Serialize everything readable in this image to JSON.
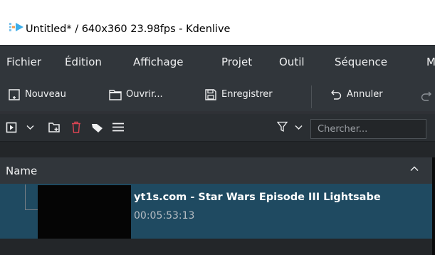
{
  "window": {
    "title": "Untitled* / 640x360 23.98fps - Kdenlive",
    "icon": "kdenlive-icon"
  },
  "menu": {
    "items": [
      "Fichier",
      "Édition",
      "Affichage",
      "Projet",
      "Outil",
      "Séquence",
      "M"
    ]
  },
  "toolbar": {
    "new_label": "Nouveau",
    "open_label": "Ouvrir...",
    "save_label": "Enregistrer",
    "undo_label": "Annuler"
  },
  "bin_toolbar": {
    "search_placeholder": "Chercher..."
  },
  "clip_list": {
    "column_name": "Name",
    "clips": [
      {
        "name": "yt1s.com - Star Wars Episode III Lightsabe",
        "duration": "00:05:53:13"
      }
    ]
  },
  "colors": {
    "selection": "#1f4a61",
    "window_bg": "#31363b",
    "delete_icon": "#da4453"
  }
}
